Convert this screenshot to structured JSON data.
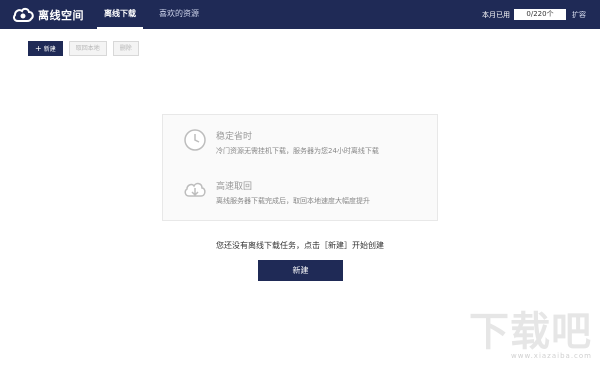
{
  "app": {
    "title": "离线空间"
  },
  "nav": {
    "tabs": [
      {
        "label": "离线下载",
        "active": true
      },
      {
        "label": "喜欢的资源",
        "active": false
      }
    ]
  },
  "usage": {
    "label": "本月已用",
    "value": "0/220个",
    "expand": "扩容"
  },
  "toolbar": {
    "new_label": "新建",
    "retrieve_label": "取回本地",
    "delete_label": "删除"
  },
  "features": [
    {
      "icon": "clock-icon",
      "title": "稳定省时",
      "desc": "冷门资源无需挂机下载，服务器为您24小时离线下载"
    },
    {
      "icon": "cloud-download-icon",
      "title": "高速取回",
      "desc": "离线服务器下载完成后，取回本地速度大幅度提升"
    }
  ],
  "empty": {
    "message": "您还没有离线下载任务，点击［新建］开始创建",
    "button": "新建"
  },
  "watermark": {
    "big": "下载吧",
    "small": "www.xiazaiba.com"
  },
  "colors": {
    "brand": "#1f2a56",
    "accent": "#ffffff"
  }
}
